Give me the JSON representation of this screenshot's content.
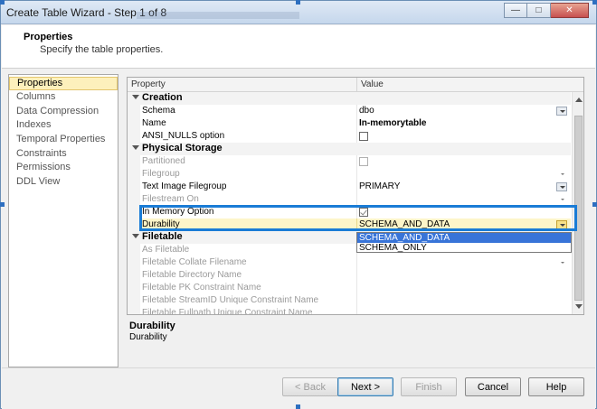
{
  "window": {
    "title": "Create Table Wizard - Step 1 of 8"
  },
  "header": {
    "title": "Properties",
    "subtitle": "Specify the table properties."
  },
  "nav": {
    "items": [
      {
        "label": "Properties",
        "selected": true
      },
      {
        "label": "Columns"
      },
      {
        "label": "Data Compression"
      },
      {
        "label": "Indexes"
      },
      {
        "label": "Temporal Properties"
      },
      {
        "label": "Constraints"
      },
      {
        "label": "Permissions"
      },
      {
        "label": "DDL View"
      }
    ]
  },
  "grid": {
    "col_property": "Property",
    "col_value": "Value",
    "rows": [
      {
        "kind": "category",
        "name": "Creation"
      },
      {
        "name": "Schema",
        "value": "dbo"
      },
      {
        "name": "Name",
        "value": "In-memorytable"
      },
      {
        "name": "ANSI_NULLS option"
      },
      {
        "kind": "category",
        "name": "Physical Storage"
      },
      {
        "name": "Partitioned"
      },
      {
        "name": "Filegroup"
      },
      {
        "name": "Text Image Filegroup",
        "value": "PRIMARY"
      },
      {
        "name": "Filestream On"
      },
      {
        "name": "In Memory Option"
      },
      {
        "name": "Durability",
        "value": "SCHEMA_AND_DATA"
      },
      {
        "kind": "category",
        "name": "Filetable"
      },
      {
        "name": "As Filetable"
      },
      {
        "name": "Filetable Collate Filename"
      },
      {
        "name": "Filetable Directory Name"
      },
      {
        "name": "Filetable PK Constraint Name"
      },
      {
        "name": "Filetable StreamID Unique Constraint Name"
      },
      {
        "name": "Filetable Fullpath Unique Constraint Name"
      }
    ]
  },
  "dropdown": {
    "options": [
      "SCHEMA_AND_DATA",
      "SCHEMA_ONLY"
    ],
    "highlighted": "SCHEMA_AND_DATA"
  },
  "description": {
    "title": "Durability",
    "text": "Durability"
  },
  "buttons": {
    "back": "< Back",
    "next": "Next >",
    "finish": "Finish",
    "cancel": "Cancel",
    "help": "Help"
  },
  "colors": {
    "accent": "#1a7cd6",
    "selection": "#fdf0bc",
    "dropdown_highlight": "#3874d8"
  }
}
